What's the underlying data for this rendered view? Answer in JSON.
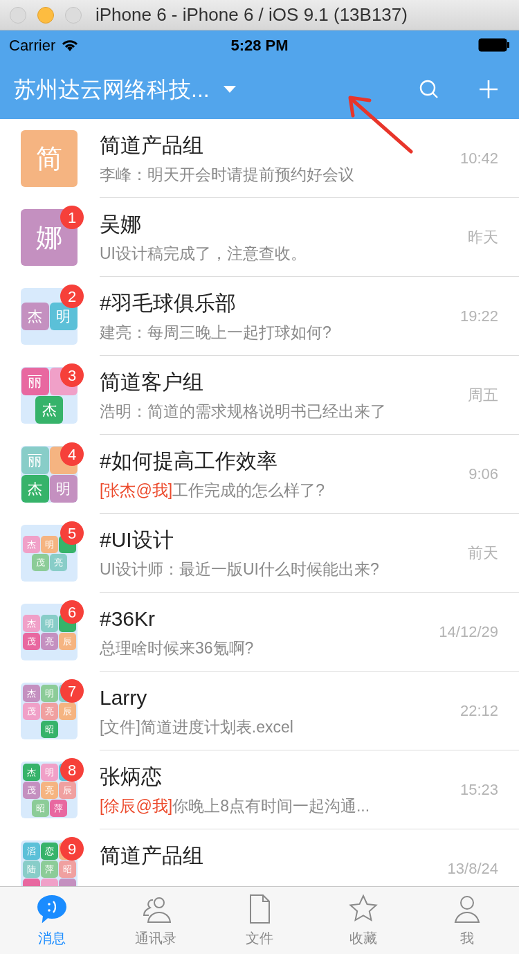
{
  "window": {
    "title": "iPhone 6 - iPhone 6 / iOS 9.1 (13B137)"
  },
  "status_bar": {
    "carrier": "Carrier",
    "time": "5:28 PM"
  },
  "nav_bar": {
    "title": "苏州达云网络科技..."
  },
  "conversations": [
    {
      "name": "简道产品组",
      "preview": {
        "text": "李峰：明天开会时请提前预约好会议"
      },
      "time": "10:42",
      "avatar": {
        "kind": "single",
        "char": "简",
        "color": "#f5b481"
      }
    },
    {
      "name": "吴娜",
      "preview": {
        "text": "UI设计稿完成了，注意查收。"
      },
      "time": "昨天",
      "badge": "1",
      "avatar": {
        "kind": "single",
        "char": "娜",
        "color": "#c490c0"
      }
    },
    {
      "name": "#羽毛球俱乐部",
      "preview": {
        "text": "建亮：每周三晚上一起打球如何?"
      },
      "time": "19:22",
      "badge": "2",
      "avatar": {
        "kind": "group",
        "tiles": [
          {
            "char": "杰",
            "color": "#c490c0"
          },
          {
            "char": "明",
            "color": "#5bc0d8"
          }
        ]
      }
    },
    {
      "name": "简道客户组",
      "preview": {
        "text": "浩明：简道的需求规格说明书已经出来了"
      },
      "time": "周五",
      "badge": "3",
      "avatar": {
        "kind": "group",
        "tiles": [
          {
            "char": "丽",
            "color": "#e868a0"
          },
          {
            "color": "#f0a0c8"
          },
          {
            "char": "杰",
            "color": "#36b36a"
          }
        ]
      }
    },
    {
      "name": "#如何提高工作效率",
      "preview": {
        "mention": "[张杰@我]",
        "text": "工作完成的怎么样了?"
      },
      "time": "9:06",
      "badge": "4",
      "avatar": {
        "kind": "group",
        "tiles": [
          {
            "char": "丽",
            "color": "#88cdc8"
          },
          {
            "color": "#f5b481"
          },
          {
            "char": "杰",
            "color": "#36b36a"
          },
          {
            "char": "明",
            "color": "#c490c0"
          }
        ]
      }
    },
    {
      "name": "#UI设计",
      "preview": {
        "text": "UI设计师：最近一版UI什么时候能出来?"
      },
      "time": "前天",
      "badge": "5",
      "avatar": {
        "kind": "group",
        "tiles": [
          {
            "char": "杰",
            "color": "#f0a0c8"
          },
          {
            "char": "明",
            "color": "#f5b481"
          },
          {
            "color": "#36b36a"
          },
          {
            "char": "茂",
            "color": "#8ccc98"
          },
          {
            "char": "亮",
            "color": "#88cdc8"
          }
        ]
      }
    },
    {
      "name": "#36Kr",
      "preview": {
        "text": "总理啥时候来36氪啊?"
      },
      "time": "14/12/29",
      "badge": "6",
      "avatar": {
        "kind": "group",
        "tiles": [
          {
            "char": "杰",
            "color": "#f0a0c8"
          },
          {
            "char": "明",
            "color": "#88cdc8"
          },
          {
            "color": "#36b36a"
          },
          {
            "char": "茂",
            "color": "#e868a0"
          },
          {
            "char": "亮",
            "color": "#c490c0"
          },
          {
            "char": "辰",
            "color": "#f5b481"
          }
        ]
      }
    },
    {
      "name": "Larry",
      "preview": {
        "text": "[文件]简道进度计划表.excel"
      },
      "time": "22:12",
      "badge": "7",
      "avatar": {
        "kind": "group",
        "tiles": [
          {
            "char": "杰",
            "color": "#c490c0"
          },
          {
            "char": "明",
            "color": "#8ccc98"
          },
          {
            "color": "#88cdc8"
          },
          {
            "char": "茂",
            "color": "#f0a0c8"
          },
          {
            "char": "亮",
            "color": "#f0a0a0"
          },
          {
            "char": "辰",
            "color": "#f5b481"
          },
          {
            "char": "昭",
            "color": "#36b36a"
          }
        ]
      }
    },
    {
      "name": "张炳恋",
      "preview": {
        "mention": "[徐辰@我]",
        "text": "你晚上8点有时间一起沟通..."
      },
      "time": "15:23",
      "badge": "8",
      "avatar": {
        "kind": "group",
        "tiles": [
          {
            "char": "杰",
            "color": "#36b36a"
          },
          {
            "char": "明",
            "color": "#f0a0c8"
          },
          {
            "color": "#5bc0d8"
          },
          {
            "char": "茂",
            "color": "#c490c0"
          },
          {
            "char": "亮",
            "color": "#f5b481"
          },
          {
            "char": "辰",
            "color": "#f0a0a0"
          },
          {
            "char": "昭",
            "color": "#8ccc98"
          },
          {
            "char": "萍",
            "color": "#e868a0"
          }
        ]
      }
    },
    {
      "name": "简道产品组",
      "time": "13/8/24",
      "badge": "9",
      "avatar": {
        "kind": "group",
        "tiles": [
          {
            "char": "滔",
            "color": "#5bc0d8"
          },
          {
            "char": "恋",
            "color": "#36b36a"
          },
          {
            "color": "#f5b481"
          },
          {
            "char": "陆",
            "color": "#88cdc8"
          },
          {
            "char": "萍",
            "color": "#8ccc98"
          },
          {
            "char": "昭",
            "color": "#f0a0a0"
          },
          {
            "color": "#e868a0"
          },
          {
            "color": "#f0a0c8"
          },
          {
            "color": "#c490c0"
          }
        ]
      }
    }
  ],
  "tabs": [
    {
      "label": "消息",
      "kind": "chat",
      "selected": true
    },
    {
      "label": "通讯录",
      "kind": "contacts",
      "selected": false
    },
    {
      "label": "文件",
      "kind": "file",
      "selected": false
    },
    {
      "label": "收藏",
      "kind": "star",
      "selected": false
    },
    {
      "label": "我",
      "kind": "me",
      "selected": false
    }
  ]
}
